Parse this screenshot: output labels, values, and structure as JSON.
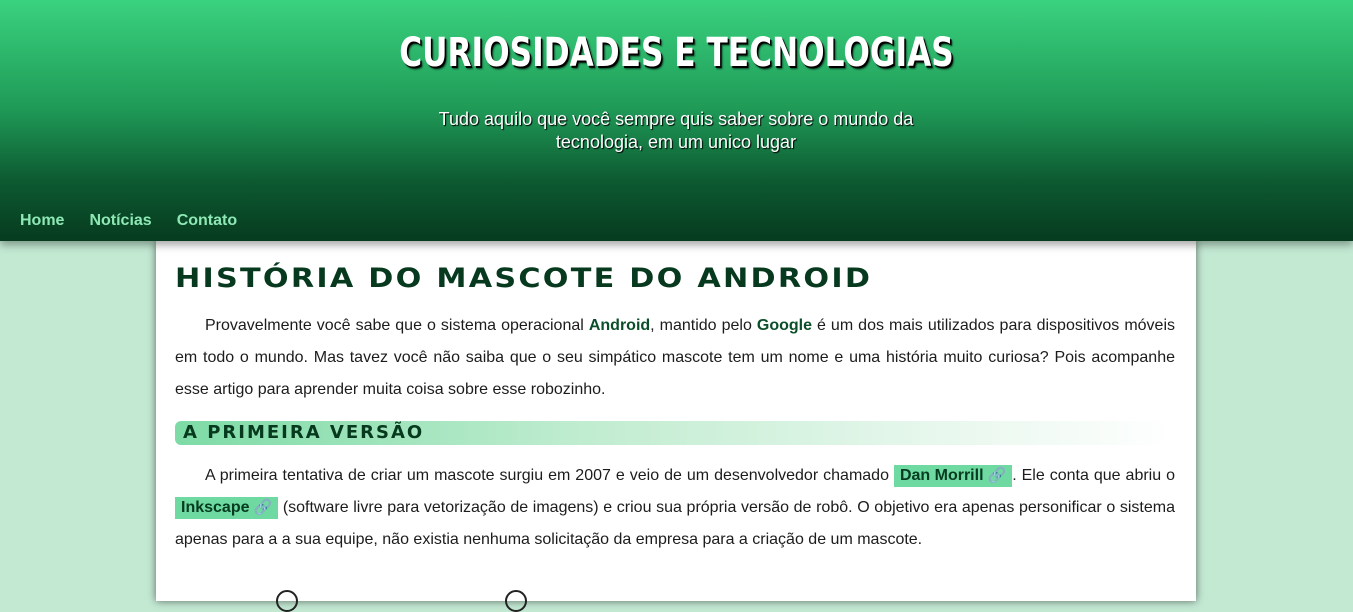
{
  "header": {
    "title": "CURIOSIDADES E TECNOLOGIAS",
    "subtitle": "Tudo aquilo que você sempre quis saber sobre o mundo da tecnologia, em um unico lugar"
  },
  "nav": {
    "items": [
      {
        "label": "Home"
      },
      {
        "label": "Notícias"
      },
      {
        "label": "Contato"
      }
    ]
  },
  "article": {
    "title": "História do mascote do Android",
    "intro": {
      "t1": "Provavelmente você sabe que o sistema operacional ",
      "android": "Android",
      "t2": ", mantido pelo ",
      "google": "Google",
      "t3": " é um dos mais utilizados para dispositivos móveis em todo o mundo. Mas tavez você não saiba que o seu simpático mascote tem um nome e uma história muito curiosa? Pois acompanhe esse artigo para aprender muita coisa sobre esse robozinho."
    },
    "section1": {
      "heading": "A primeira versão",
      "t1": "A primeira tentativa de criar um mascote surgiu em 2007 e veio de um desenvolvedor chamado ",
      "link1": "Dan Morrill",
      "t2": ". Ele conta que abriu o ",
      "link2": "Inkscape",
      "t3": " (software livre para vetorização de imagens) e criou sua própria versão de robô. O objetivo era apenas personificar o sistema apenas para a a sua equipe, não existia nenhuma solicitação da empresa para a criação de um mascote."
    }
  },
  "icons": {
    "link_icon": "🔗"
  },
  "colors": {
    "header_top": "#3ad27f",
    "header_bottom": "#063b1f",
    "page_background": "#c3e9d3",
    "nav_link": "#8ee8b4",
    "chip_background": "#6ed9a0",
    "heading_text": "#06391d"
  }
}
